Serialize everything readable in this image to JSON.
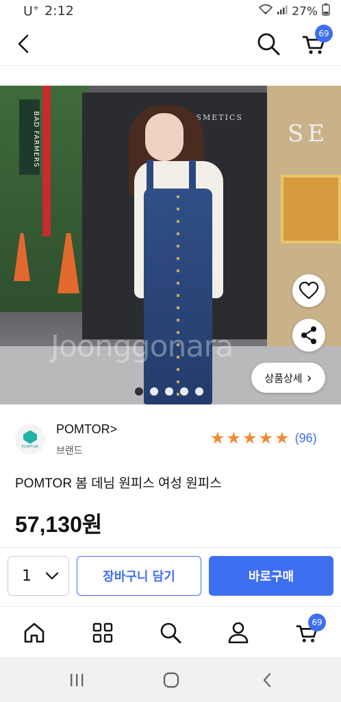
{
  "status_bar": {
    "carrier": "U",
    "carrier_sup": "+",
    "time": "2:12",
    "battery": "27%"
  },
  "header": {
    "cart_count": "69"
  },
  "product_image": {
    "watermark": "Joonggonara",
    "sign_bad_farmers": "BAD FARMERS",
    "sign_cosmetics": "COSMETICS",
    "sign_sel": "SE",
    "detail_button_label": "상품상세",
    "detail_button_chevron": "›",
    "carousel_total": 5,
    "carousel_active": 1
  },
  "brand": {
    "logo_text": "POMTOR",
    "name": "POMTOR>",
    "label": "브랜드",
    "rating_stars": 5,
    "review_count": "(96)"
  },
  "product": {
    "title": "POMTOR 봄 데님 원피스 여성 원피스",
    "price": "57,130원"
  },
  "purchase": {
    "quantity": "1",
    "add_to_cart_label": "장바구니 담기",
    "buy_now_label": "바로구매"
  },
  "bottom_nav": {
    "cart_count": "69",
    "items": [
      "home-icon",
      "category-icon",
      "search-icon",
      "my-page-icon",
      "cart-icon"
    ]
  },
  "colors": {
    "accent": "#3e6ff0",
    "star": "#f08a2c"
  }
}
